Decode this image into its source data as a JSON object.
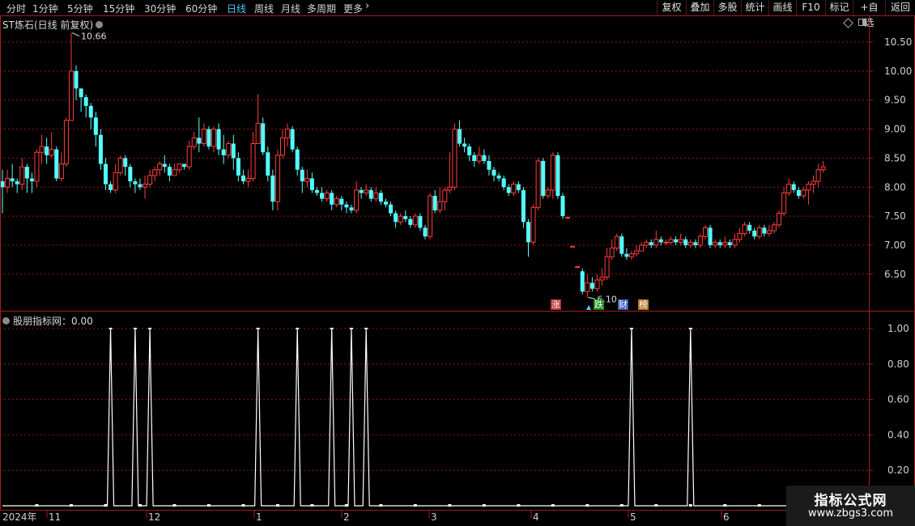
{
  "toolbar": {
    "periods": [
      "分时",
      "1分钟",
      "5分钟",
      "15分钟",
      "30分钟",
      "60分钟",
      "日线",
      "周线",
      "月线",
      "多周期",
      "更多"
    ],
    "active_period": "日线",
    "more_icon": "chevron-right-icon",
    "right_buttons": [
      "复权",
      "叠加",
      "多股",
      "统计",
      "画线",
      "F10",
      "标记",
      "+自选",
      "返回"
    ]
  },
  "main_chart": {
    "stock_name": "ST炼石",
    "mode": "(日线 前复权)",
    "high_label": "10.66",
    "low_label": "6.10",
    "price_ticks": [
      "10.50",
      "10.00",
      "9.50",
      "9.00",
      "8.50",
      "8.00",
      "7.50",
      "7.00",
      "6.50"
    ]
  },
  "badges": [
    {
      "text": "涨",
      "color": "#b83232"
    },
    {
      "text": "跌",
      "color": "#1e8c1e"
    },
    {
      "text": "财",
      "color": "#3a5fb8"
    },
    {
      "text": "榜",
      "color": "#b8792a"
    }
  ],
  "indicator": {
    "title": "股朋指标网：0.00",
    "ticks": [
      "1.00",
      "0.80",
      "0.60",
      "0.40",
      "0.20"
    ]
  },
  "date_axis": [
    "2024年",
    "11",
    "12",
    "1",
    "2",
    "3",
    "4",
    "5",
    "6"
  ],
  "watermark": {
    "line1": "指标公式网",
    "line2": "www.zbgs3.com"
  },
  "colors": {
    "up": "#ff3c3c",
    "down": "#54ffff",
    "grid": "#8c1a1a",
    "border": "#a01e1e",
    "indicator": "#ffffff"
  },
  "chart_data": {
    "type": "candlestick",
    "title": "ST炼石 (日线 前复权)",
    "ylim": [
      5.95,
      10.85
    ],
    "candles": [
      [
        8.1,
        8.0,
        8.3,
        7.55
      ],
      [
        8.0,
        8.15,
        8.3,
        7.9
      ],
      [
        8.15,
        8.1,
        8.4,
        8.0
      ],
      [
        8.1,
        8.05,
        8.15,
        7.9
      ],
      [
        8.05,
        8.35,
        8.5,
        7.95
      ],
      [
        8.35,
        8.15,
        8.4,
        7.9
      ],
      [
        8.15,
        8.1,
        8.25,
        7.9
      ],
      [
        8.1,
        8.6,
        8.65,
        8.0
      ],
      [
        8.6,
        8.7,
        8.9,
        8.4
      ],
      [
        8.7,
        8.55,
        8.85,
        8.4
      ],
      [
        8.55,
        8.65,
        8.95,
        8.5
      ],
      [
        8.65,
        8.15,
        8.7,
        8.1
      ],
      [
        8.15,
        8.4,
        8.6,
        8.1
      ],
      [
        8.4,
        9.15,
        9.2,
        8.35
      ],
      [
        9.15,
        10.0,
        10.66,
        9.55
      ],
      [
        10.0,
        9.7,
        10.1,
        9.5
      ],
      [
        9.7,
        9.55,
        9.7,
        9.3
      ],
      [
        9.55,
        9.4,
        9.6,
        9.2
      ],
      [
        9.4,
        9.2,
        9.45,
        9.0
      ],
      [
        9.2,
        8.9,
        9.3,
        8.7
      ],
      [
        8.9,
        8.4,
        9.0,
        8.3
      ],
      [
        8.4,
        8.05,
        8.5,
        7.95
      ],
      [
        8.05,
        7.95,
        8.1,
        7.9
      ],
      [
        7.95,
        8.25,
        8.4,
        7.9
      ],
      [
        8.25,
        8.5,
        8.55,
        8.2
      ],
      [
        8.5,
        8.35,
        8.55,
        8.2
      ],
      [
        8.35,
        8.1,
        8.4,
        8.0
      ],
      [
        8.1,
        8.05,
        8.15,
        7.9
      ],
      [
        8.05,
        8.0,
        8.15,
        7.95
      ],
      [
        8.0,
        8.05,
        8.2,
        7.8
      ],
      [
        8.05,
        8.2,
        8.3,
        8.0
      ],
      [
        8.2,
        8.3,
        8.35,
        8.1
      ],
      [
        8.3,
        8.4,
        8.45,
        8.2
      ],
      [
        8.4,
        8.35,
        8.55,
        8.25
      ],
      [
        8.35,
        8.2,
        8.4,
        8.1
      ],
      [
        8.2,
        8.3,
        8.4,
        8.2
      ],
      [
        8.3,
        8.4,
        8.4,
        8.25
      ],
      [
        8.4,
        8.35,
        8.4,
        8.3
      ],
      [
        8.35,
        8.7,
        8.8,
        8.3
      ],
      [
        8.7,
        8.85,
        8.95,
        8.65
      ],
      [
        8.85,
        8.75,
        9.2,
        8.6
      ],
      [
        8.75,
        9.0,
        9.1,
        8.7
      ],
      [
        9.0,
        8.7,
        9.05,
        8.65
      ],
      [
        8.7,
        9.0,
        9.05,
        8.6
      ],
      [
        9.0,
        8.65,
        9.1,
        8.55
      ],
      [
        8.65,
        8.55,
        8.9,
        8.4
      ],
      [
        8.55,
        8.75,
        8.8,
        8.5
      ],
      [
        8.75,
        8.5,
        8.9,
        8.3
      ],
      [
        8.5,
        8.2,
        8.6,
        8.1
      ],
      [
        8.2,
        8.1,
        8.3,
        8.05
      ],
      [
        8.1,
        8.15,
        8.3,
        8.0
      ],
      [
        8.15,
        8.75,
        8.95,
        8.1
      ],
      [
        8.75,
        9.1,
        9.6,
        9.0
      ],
      [
        9.1,
        8.6,
        9.2,
        8.55
      ],
      [
        8.6,
        8.2,
        8.7,
        8.1
      ],
      [
        8.2,
        7.75,
        8.3,
        7.6
      ],
      [
        7.75,
        8.55,
        8.65,
        7.6
      ],
      [
        8.55,
        8.85,
        9.0,
        8.5
      ],
      [
        8.85,
        9.0,
        9.1,
        8.7
      ],
      [
        9.0,
        8.65,
        9.05,
        8.6
      ],
      [
        8.65,
        8.3,
        8.7,
        8.2
      ],
      [
        8.3,
        8.1,
        8.35,
        7.9
      ],
      [
        8.1,
        8.15,
        8.3,
        8.0
      ],
      [
        8.15,
        7.95,
        8.25,
        7.9
      ],
      [
        7.95,
        7.9,
        8.0,
        7.85
      ],
      [
        7.9,
        7.8,
        8.0,
        7.75
      ],
      [
        7.8,
        7.9,
        7.95,
        7.75
      ],
      [
        7.9,
        7.7,
        7.95,
        7.6
      ],
      [
        7.7,
        7.8,
        7.85,
        7.65
      ],
      [
        7.8,
        7.7,
        7.85,
        7.6
      ],
      [
        7.7,
        7.65,
        7.75,
        7.55
      ],
      [
        7.65,
        7.6,
        7.7,
        7.55
      ],
      [
        7.6,
        7.95,
        8.1,
        7.55
      ],
      [
        7.95,
        7.9,
        8.0,
        7.8
      ],
      [
        7.9,
        7.95,
        8.05,
        7.85
      ],
      [
        7.95,
        7.8,
        8.0,
        7.75
      ],
      [
        7.8,
        7.9,
        8.0,
        7.75
      ],
      [
        7.9,
        7.75,
        7.95,
        7.7
      ],
      [
        7.75,
        7.7,
        7.8,
        7.65
      ],
      [
        7.7,
        7.55,
        7.75,
        7.5
      ],
      [
        7.55,
        7.4,
        7.6,
        7.3
      ],
      [
        7.4,
        7.5,
        7.55,
        7.35
      ],
      [
        7.5,
        7.45,
        7.6,
        7.4
      ],
      [
        7.45,
        7.35,
        7.5,
        7.3
      ],
      [
        7.35,
        7.5,
        7.55,
        7.3
      ],
      [
        7.5,
        7.3,
        7.55,
        7.25
      ],
      [
        7.3,
        7.15,
        7.35,
        7.1
      ],
      [
        7.15,
        7.85,
        7.9,
        7.1
      ],
      [
        7.85,
        7.6,
        7.95,
        7.55
      ],
      [
        7.6,
        7.75,
        8.0,
        7.55
      ],
      [
        7.75,
        7.95,
        8.0,
        7.6
      ],
      [
        7.95,
        8.0,
        8.6,
        7.9
      ],
      [
        8.0,
        9.0,
        9.1,
        7.95
      ],
      [
        9.0,
        8.75,
        9.15,
        8.7
      ],
      [
        8.75,
        8.7,
        8.85,
        8.6
      ],
      [
        8.7,
        8.55,
        8.75,
        8.45
      ],
      [
        8.55,
        8.45,
        8.6,
        8.35
      ],
      [
        8.45,
        8.55,
        8.7,
        8.4
      ],
      [
        8.55,
        8.45,
        8.65,
        8.4
      ],
      [
        8.45,
        8.3,
        8.55,
        8.2
      ],
      [
        8.3,
        8.2,
        8.35,
        8.1
      ],
      [
        8.2,
        8.15,
        8.25,
        8.1
      ],
      [
        8.15,
        8.0,
        8.2,
        7.95
      ],
      [
        8.0,
        7.9,
        8.05,
        7.85
      ],
      [
        7.9,
        8.05,
        8.1,
        7.85
      ],
      [
        8.05,
        7.95,
        8.1,
        7.9
      ],
      [
        7.95,
        7.4,
        8.0,
        7.3
      ],
      [
        7.4,
        7.05,
        7.45,
        6.8
      ],
      [
        7.05,
        7.65,
        7.7,
        7.0
      ],
      [
        7.65,
        8.45,
        8.5,
        7.6
      ],
      [
        8.45,
        7.85,
        8.5,
        7.8
      ],
      [
        7.85,
        7.95,
        8.0,
        7.8
      ],
      [
        7.95,
        8.55,
        8.6,
        7.8
      ],
      [
        8.55,
        7.85,
        8.6,
        7.8
      ],
      [
        7.85,
        7.5,
        7.9,
        7.45
      ],
      [
        7.48,
        7.48,
        7.48,
        7.48
      ],
      [
        6.98,
        6.98,
        6.98,
        6.98
      ],
      [
        6.63,
        6.63,
        6.63,
        6.63
      ],
      [
        6.55,
        6.2,
        6.6,
        6.15
      ],
      [
        6.2,
        6.35,
        6.5,
        6.1
      ],
      [
        6.35,
        6.25,
        6.45,
        6.2
      ],
      [
        6.25,
        6.4,
        6.5,
        6.2
      ],
      [
        6.4,
        6.45,
        6.6,
        6.3
      ],
      [
        6.45,
        6.8,
        6.95,
        6.4
      ],
      [
        6.8,
        6.95,
        7.1,
        6.75
      ],
      [
        6.95,
        7.15,
        7.2,
        6.9
      ],
      [
        7.15,
        6.85,
        7.2,
        6.8
      ],
      [
        6.85,
        6.8,
        6.95,
        6.75
      ],
      [
        6.8,
        6.85,
        6.9,
        6.75
      ],
      [
        6.85,
        6.9,
        7.0,
        6.8
      ],
      [
        6.9,
        7.0,
        7.05,
        6.9
      ],
      [
        7.0,
        7.05,
        7.1,
        6.95
      ],
      [
        7.05,
        7.0,
        7.1,
        6.95
      ],
      [
        7.0,
        7.1,
        7.25,
        6.95
      ],
      [
        7.1,
        7.05,
        7.15,
        7.0
      ],
      [
        7.05,
        7.05,
        7.1,
        7.0
      ],
      [
        7.05,
        7.1,
        7.15,
        7.0
      ],
      [
        7.1,
        7.05,
        7.15,
        7.0
      ],
      [
        7.05,
        7.1,
        7.2,
        7.0
      ],
      [
        7.1,
        7.0,
        7.15,
        6.95
      ],
      [
        7.0,
        7.05,
        7.1,
        6.95
      ],
      [
        7.05,
        7.0,
        7.1,
        6.95
      ],
      [
        7.0,
        7.15,
        7.2,
        6.95
      ],
      [
        7.15,
        7.3,
        7.35,
        7.1
      ],
      [
        7.3,
        7.0,
        7.35,
        6.95
      ],
      [
        7.0,
        7.05,
        7.1,
        6.95
      ],
      [
        7.05,
        7.0,
        7.1,
        6.95
      ],
      [
        7.0,
        7.05,
        7.15,
        6.95
      ],
      [
        7.05,
        7.0,
        7.1,
        6.95
      ],
      [
        7.0,
        7.1,
        7.2,
        6.95
      ],
      [
        7.1,
        7.2,
        7.3,
        7.05
      ],
      [
        7.2,
        7.35,
        7.4,
        7.15
      ],
      [
        7.35,
        7.25,
        7.4,
        7.2
      ],
      [
        7.25,
        7.15,
        7.3,
        7.1
      ],
      [
        7.15,
        7.3,
        7.35,
        7.1
      ],
      [
        7.3,
        7.2,
        7.35,
        7.15
      ],
      [
        7.2,
        7.25,
        7.35,
        7.15
      ],
      [
        7.25,
        7.35,
        7.4,
        7.2
      ],
      [
        7.35,
        7.55,
        7.6,
        7.3
      ],
      [
        7.55,
        7.9,
        8.0,
        7.5
      ],
      [
        7.9,
        8.05,
        8.15,
        7.85
      ],
      [
        8.05,
        7.95,
        8.1,
        7.9
      ],
      [
        7.95,
        7.85,
        8.0,
        7.8
      ],
      [
        7.85,
        7.95,
        8.0,
        7.8
      ],
      [
        7.95,
        8.05,
        8.1,
        7.7
      ],
      [
        8.05,
        8.1,
        8.2,
        7.9
      ],
      [
        8.1,
        8.3,
        8.4,
        8.0
      ],
      [
        8.3,
        8.35,
        8.45,
        8.25
      ]
    ],
    "indicator_spikes": [
      22,
      27,
      30,
      52,
      60,
      67,
      71,
      74,
      128,
      140
    ],
    "indicator_range": [
      0,
      1
    ]
  }
}
